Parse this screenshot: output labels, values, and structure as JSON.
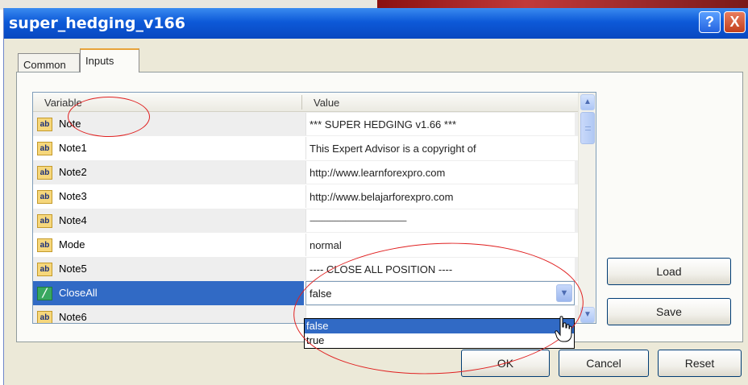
{
  "window": {
    "title": "super_hedging_v166",
    "help_glyph": "?",
    "close_glyph": "X"
  },
  "tabs": [
    {
      "label": "Common",
      "active": false
    },
    {
      "label": "Inputs",
      "active": true
    }
  ],
  "table": {
    "columns": [
      "Variable",
      "Value"
    ],
    "rows": [
      {
        "icon": "ab",
        "name": "Note",
        "value": "*** SUPER HEDGING v1.66 ***"
      },
      {
        "icon": "ab",
        "name": "Note1",
        "value": "This Expert Advisor is a copyright of"
      },
      {
        "icon": "ab",
        "name": "Note2",
        "value": "http://www.learnforexpro.com"
      },
      {
        "icon": "ab",
        "name": "Note3",
        "value": "http://www.belajarforexpro.com"
      },
      {
        "icon": "ab",
        "name": "Note4",
        "value": "------------------------------------------------------------"
      },
      {
        "icon": "ab",
        "name": "Mode",
        "value": "normal"
      },
      {
        "icon": "ab",
        "name": "Note5",
        "value": "---- CLOSE ALL POSITION ----"
      },
      {
        "icon": "bool",
        "name": "CloseAll",
        "value": "false",
        "selected": true
      },
      {
        "icon": "ab",
        "name": "Note6",
        "value": ""
      }
    ]
  },
  "dropdown": {
    "options": [
      "false",
      "true"
    ],
    "highlighted": "false"
  },
  "buttons": {
    "load": "Load",
    "save": "Save",
    "ok": "OK",
    "cancel": "Cancel",
    "reset": "Reset"
  },
  "colors": {
    "titlebar": "#0d59d8",
    "selection": "#316ac5",
    "annotation": "#e02020",
    "dialog_bg": "#ece9d8"
  }
}
